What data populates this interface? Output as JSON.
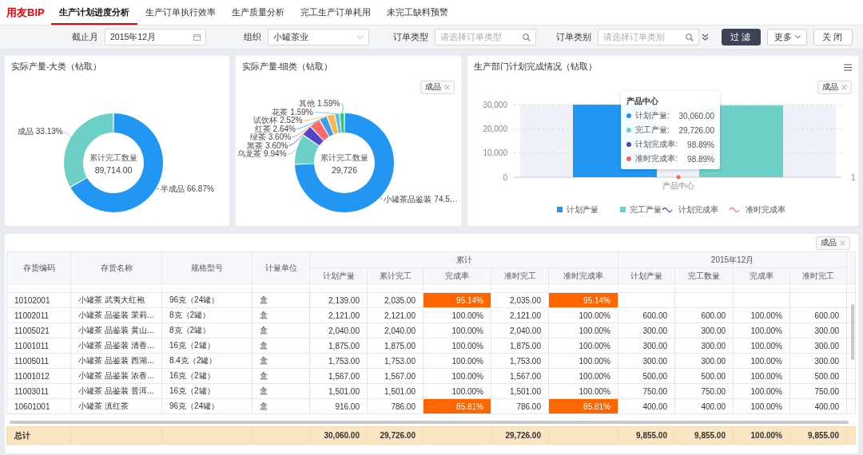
{
  "header": {
    "logo": "用友BIP",
    "tabs": [
      {
        "label": "生产计划进度分析",
        "selected": true
      },
      {
        "label": "生产订单执行效率",
        "selected": false
      },
      {
        "label": "生产质量分析",
        "selected": false
      },
      {
        "label": "完工生产订单耗用",
        "selected": false
      },
      {
        "label": "未完工缺料预警",
        "selected": false
      }
    ]
  },
  "filters": [
    {
      "kind": "date",
      "label": "截止月",
      "value": "2015年12月"
    },
    {
      "kind": "select",
      "label": "组织",
      "value": "小罐茶业"
    },
    {
      "kind": "search",
      "label": "订单类型",
      "placeholder": "请选择订单类型"
    },
    {
      "kind": "search",
      "label": "订单类别",
      "placeholder": "请选择订单类别"
    }
  ],
  "buttons": [
    {
      "kind": "primary",
      "label": "过滤"
    },
    {
      "kind": "dropdown",
      "label": "更多"
    },
    {
      "kind": "default",
      "label": "关闭"
    }
  ],
  "charts": [
    {
      "title": "实际产量-大类（钻取）",
      "center_label": "累计完工数量",
      "center_value": "89,714.00",
      "chart_data": {
        "type": "donut",
        "categories": [
          "半成品",
          "成品"
        ],
        "values": [
          66.87,
          33.13
        ],
        "colors": [
          "#2196f3",
          "#6dd0c7"
        ],
        "value_labels": [
          "66.87%",
          "33.13%"
        ]
      }
    },
    {
      "title": "实际产量-细类（钻取）",
      "chip": "成品",
      "center_label": "累计完工数量",
      "center_value": "29,726",
      "chart_data": {
        "type": "donut",
        "categories": [
          "小罐茶品鉴装",
          "乌龙茶",
          "黑茶",
          "绿茶",
          "红茶",
          "试饮杯",
          "花茶",
          "其他"
        ],
        "values": [
          74.52,
          9.94,
          3.6,
          3.6,
          2.64,
          2.52,
          1.59,
          1.59
        ],
        "colors": [
          "#2196f3",
          "#6dd0c7",
          "#5146c8",
          "#fe6b6b",
          "#3c9ee6",
          "#f8b552",
          "#5ebbf2",
          "#2ecc71"
        ],
        "value_labels": [
          "74.5…",
          "9.94%",
          "3.60%",
          "3.60%",
          "2.64%",
          "2.52%",
          "1.59%",
          "1.59%"
        ]
      }
    },
    {
      "title": "生产部门计划完成情况（钻取）",
      "chip": "成品",
      "right_axis_label": "1",
      "tooltip": {
        "title": "产品中心",
        "rows": [
          {
            "label": "计划产量:",
            "value": "30,060.00",
            "color": "#2196f3"
          },
          {
            "label": "完工产量:",
            "value": "29,726.00",
            "color": "#6dd0c7"
          },
          {
            "label": "计划完成率:",
            "value": "98.89%",
            "color": "#4b3fc4"
          },
          {
            "label": "准时完成率:",
            "value": "98.89%",
            "color": "#fe5f5f"
          }
        ]
      },
      "chart_data": {
        "type": "bar",
        "categories": [
          "产品中心"
        ],
        "series": [
          {
            "name": "计划产量",
            "color": "#2196f3",
            "values": [
              30060
            ]
          },
          {
            "name": "完工产量",
            "color": "#6dd0c7",
            "values": [
              29726
            ]
          },
          {
            "name": "计划完成率",
            "color": "#4b3fc4",
            "values": [
              null
            ]
          },
          {
            "name": "准时完成率",
            "color": "#fe6b6b",
            "values": [
              null
            ]
          }
        ],
        "legend": "bottom",
        "ylim": [
          0,
          30100
        ],
        "yticks": [
          {
            "value": 0,
            "label": "0"
          },
          {
            "value": 10000,
            "label": "10,000"
          },
          {
            "value": 20000,
            "label": "20,000"
          },
          {
            "value": 30000,
            "label": "30,000"
          }
        ]
      }
    }
  ],
  "table": {
    "chip": "成品",
    "columns": [
      "存货编码",
      "存货名称",
      "规格型号",
      "计量单位"
    ],
    "groups": [
      {
        "label": "累计",
        "columns": [
          "计划产量",
          "累计完工",
          "完成率",
          "准时完工",
          "准时完成率"
        ]
      },
      {
        "label": "2015年12月",
        "columns": [
          "计划产量",
          "完工数量",
          "完成率",
          "准时完工"
        ]
      }
    ],
    "rows": [
      {
        "code": "10102001",
        "name": "小罐茶 武夷大红袍",
        "spec": "96克（24罐）",
        "unit": "盒",
        "cumulative": [
          "2,139.00",
          "2,035.00",
          "95.14%",
          "2,035.00",
          "95.14%"
        ],
        "below_target": true
      },
      {
        "code": "11002011",
        "name": "小罐茶 品鉴装 茉莉…",
        "spec": "8克（2罐）",
        "unit": "盒",
        "cumulative": [
          "2,121.00",
          "2,121.00",
          "100.00%",
          "2,121.00",
          "100.00%"
        ],
        "below_target": false,
        "month": [
          "600.00",
          "600.00",
          "100.00%",
          "600.00"
        ]
      },
      {
        "code": "11005021",
        "name": "小罐茶 品鉴装 黄山…",
        "spec": "8克（2罐）",
        "unit": "盒",
        "cumulative": [
          "2,040.00",
          "2,040.00",
          "100.00%",
          "2,040.00",
          "100.00%"
        ],
        "below_target": false,
        "month": [
          "300.00",
          "300.00",
          "100.00%",
          "300.00"
        ]
      },
      {
        "code": "11001011",
        "name": "小罐茶 品鉴装 清香…",
        "spec": "16克（2罐）",
        "unit": "盒",
        "cumulative": [
          "1,875.00",
          "1,875.00",
          "100.00%",
          "1,875.00",
          "100.00%"
        ],
        "below_target": false,
        "month": [
          "300.00",
          "300.00",
          "100.00%",
          "300.00"
        ]
      },
      {
        "code": "11005011",
        "name": "小罐茶 品鉴装 西湖…",
        "spec": "8.4克（2罐）",
        "unit": "盒",
        "cumulative": [
          "1,753.00",
          "1,753.00",
          "100.00%",
          "1,753.00",
          "100.00%"
        ],
        "below_target": false,
        "month": [
          "300.00",
          "300.00",
          "100.00%",
          "300.00"
        ]
      },
      {
        "code": "11001012",
        "name": "小罐茶 品鉴装 浓香…",
        "spec": "16克（2罐）",
        "unit": "盒",
        "cumulative": [
          "1,567.00",
          "1,567.00",
          "100.00%",
          "1,567.00",
          "100.00%"
        ],
        "below_target": false,
        "month": [
          "500.00",
          "500.00",
          "100.00%",
          "500.00"
        ]
      },
      {
        "code": "11003011",
        "name": "小罐茶 品鉴装 普洱…",
        "spec": "16克（2罐）",
        "unit": "盒",
        "cumulative": [
          "1,501.00",
          "1,501.00",
          "100.00%",
          "1,501.00",
          "100.00%"
        ],
        "below_target": false,
        "month": [
          "750.00",
          "750.00",
          "100.00%",
          "750.00"
        ]
      },
      {
        "code": "10601001",
        "name": "小罐茶 滇红茶",
        "spec": "96克（24罐）",
        "unit": "盒",
        "cumulative": [
          "916.00",
          "786.00",
          "85.81%",
          "786.00",
          "85.81%"
        ],
        "below_target": true,
        "month": [
          "400.00",
          "400.00",
          "100.00%",
          "400.00"
        ]
      }
    ],
    "total": {
      "label": "总计",
      "plan": "30,060.00",
      "done": "29,726.00",
      "ontime": "29,726.00",
      "month": [
        "9,855.00",
        "9,855.00",
        "100.00%",
        "9,855.00"
      ]
    }
  }
}
